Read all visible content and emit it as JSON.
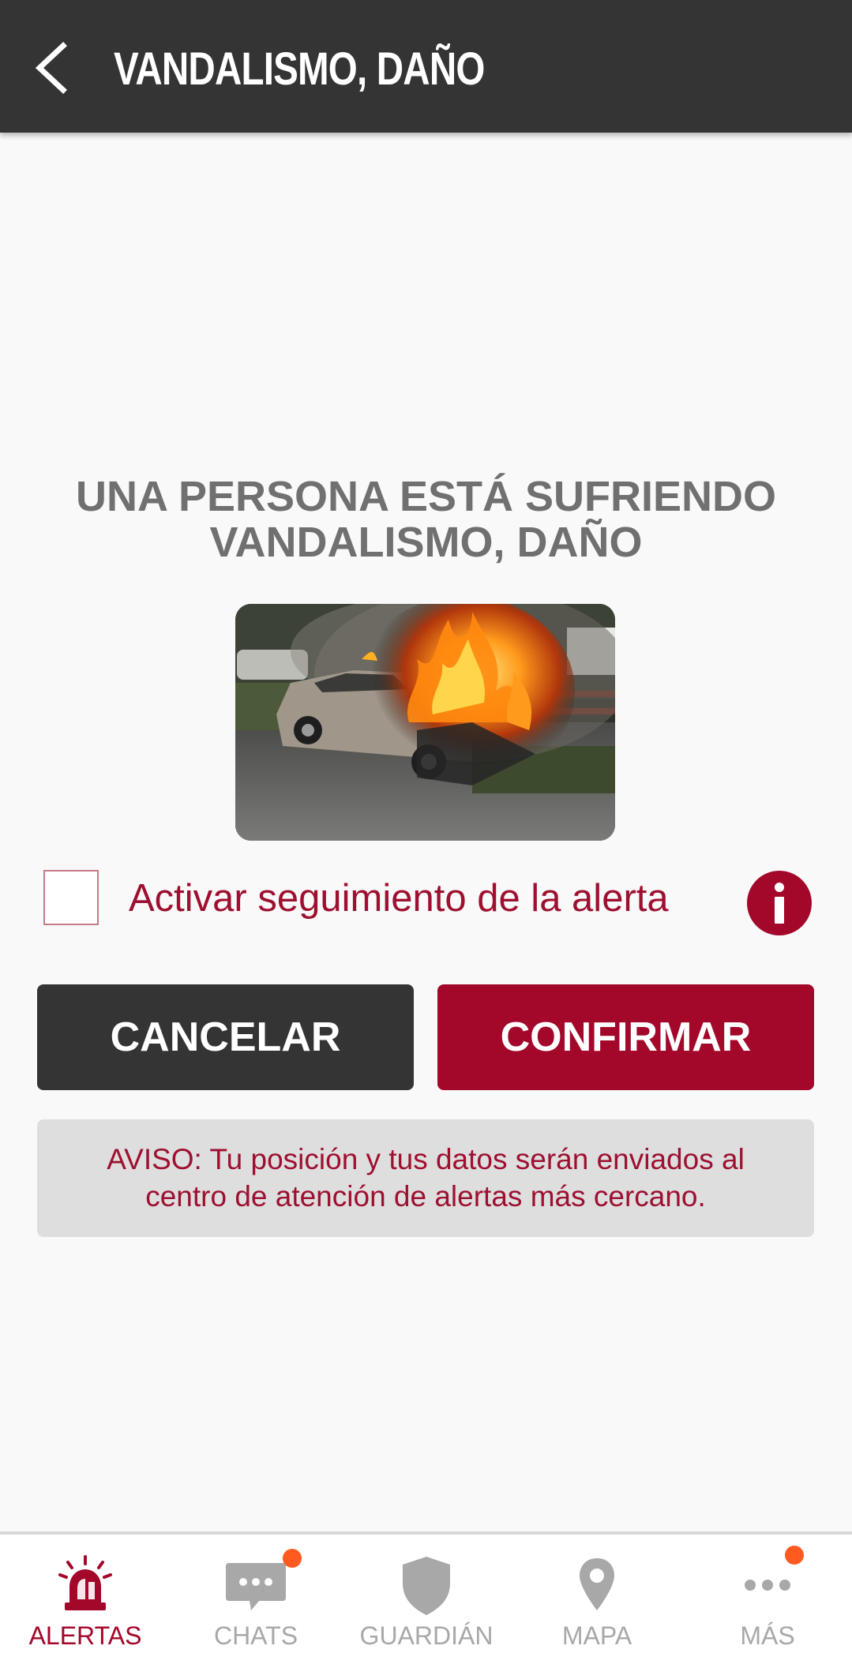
{
  "header": {
    "title": "VANDALISMO, DAÑO",
    "back_icon": "chevron-left-icon"
  },
  "main": {
    "headline_line1": "UNA PERSONA ESTÁ SUFRIENDO",
    "headline_line2": "VANDALISMO, DAÑO",
    "image_subject": "car on fire",
    "follow_checkbox": {
      "label": "Activar seguimiento de la alerta",
      "checked": false
    },
    "info_icon": "info-icon",
    "cancel_label": "CANCELAR",
    "confirm_label": "CONFIRMAR",
    "notice_line1": "AVISO: Tu posición y tus datos serán enviados al",
    "notice_line2": "centro de atención de alertas más cercano."
  },
  "bottom_nav": {
    "items": [
      {
        "label": "ALERTAS",
        "icon": "siren-icon",
        "active": true,
        "badge": false
      },
      {
        "label": "CHATS",
        "icon": "chat-bubble-icon",
        "active": false,
        "badge": true
      },
      {
        "label": "GUARDIÁN",
        "icon": "shield-icon",
        "active": false,
        "badge": false
      },
      {
        "label": "MAPA",
        "icon": "map-pin-icon",
        "active": false,
        "badge": false
      },
      {
        "label": "MÁS",
        "icon": "more-dots-icon",
        "active": false,
        "badge": true
      }
    ]
  },
  "colors": {
    "brand_red": "#a3072a",
    "header_dark": "#343434",
    "text_gray": "#707070",
    "notice_bg": "#dedede",
    "badge_orange": "#ff5a1f",
    "nav_inactive": "#a8a8a8"
  }
}
